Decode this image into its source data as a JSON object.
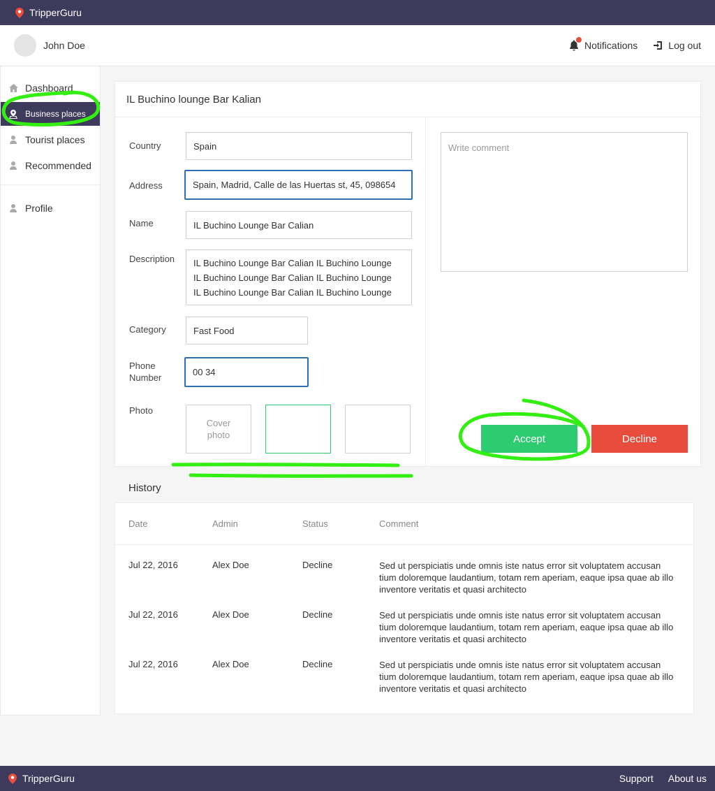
{
  "app": {
    "brand": "TripperGuru"
  },
  "user": {
    "name": "John Doe"
  },
  "header": {
    "notifications_label": "Notifications",
    "logout_label": "Log out"
  },
  "sidebar": {
    "items": [
      {
        "label": "Dashboard",
        "icon": "home-icon"
      },
      {
        "label": "Business places",
        "icon": "location-icon",
        "active": true
      },
      {
        "label": "Tourist places",
        "icon": "person-icon"
      },
      {
        "label": "Recommended",
        "icon": "person-icon"
      }
    ],
    "profile": {
      "label": "Profile",
      "icon": "person-icon"
    }
  },
  "place": {
    "title": "IL Buchino lounge Bar Kalian",
    "country_label": "Country",
    "country": "Spain",
    "address_label": "Address",
    "address": "Spain, Madrid, Calle de las Huertas st, 45, 098654",
    "name_label": "Name",
    "name": "IL Buchino Lounge Bar Calian",
    "description_label": "Description",
    "description": "IL Buchino Lounge Bar Calian IL Buchino Lounge\nIL Buchino Lounge Bar Calian IL Buchino Lounge\nIL Buchino Lounge Bar Calian IL Buchino Lounge",
    "category_label": "Category",
    "category": "Fast Food",
    "phone_label": "Phone\nNumber",
    "phone": "00 34",
    "photo_label": "Photo",
    "cover_photo_label": "Cover\nphoto"
  },
  "review": {
    "comment_placeholder": "Write comment",
    "accept_label": "Accept",
    "decline_label": "Decline"
  },
  "history": {
    "title": "History",
    "columns": [
      "Date",
      "Admin",
      "Status",
      "Comment"
    ],
    "rows": [
      {
        "date": "Jul 22, 2016",
        "admin": "Alex Doe",
        "status": "Decline",
        "comment": "Sed ut perspiciatis unde omnis iste natus error sit voluptatem accusan tium doloremque laudantium, totam rem aperiam, eaque ipsa quae ab illo inventore veritatis et quasi architecto"
      },
      {
        "date": "Jul 22, 2016",
        "admin": "Alex Doe",
        "status": "Decline",
        "comment": "Sed ut perspiciatis unde omnis iste natus error sit voluptatem accusan tium doloremque laudantium, totam rem aperiam, eaque ipsa quae ab illo inventore veritatis et quasi architecto"
      },
      {
        "date": "Jul 22, 2016",
        "admin": "Alex Doe",
        "status": "Decline",
        "comment": "Sed ut perspiciatis unde omnis iste natus error sit voluptatem accusan tium doloremque laudantium, totam rem aperiam, eaque ipsa quae ab illo inventore veritatis et quasi architecto"
      }
    ]
  },
  "footer": {
    "brand": "TripperGuru",
    "support_label": "Support",
    "about_label": "About us"
  },
  "colors": {
    "nav": "#3d3a5c",
    "accept": "#2ecc71",
    "decline": "#e74c3c",
    "focus": "#2e6fb3",
    "annotation": "#33ee11"
  }
}
